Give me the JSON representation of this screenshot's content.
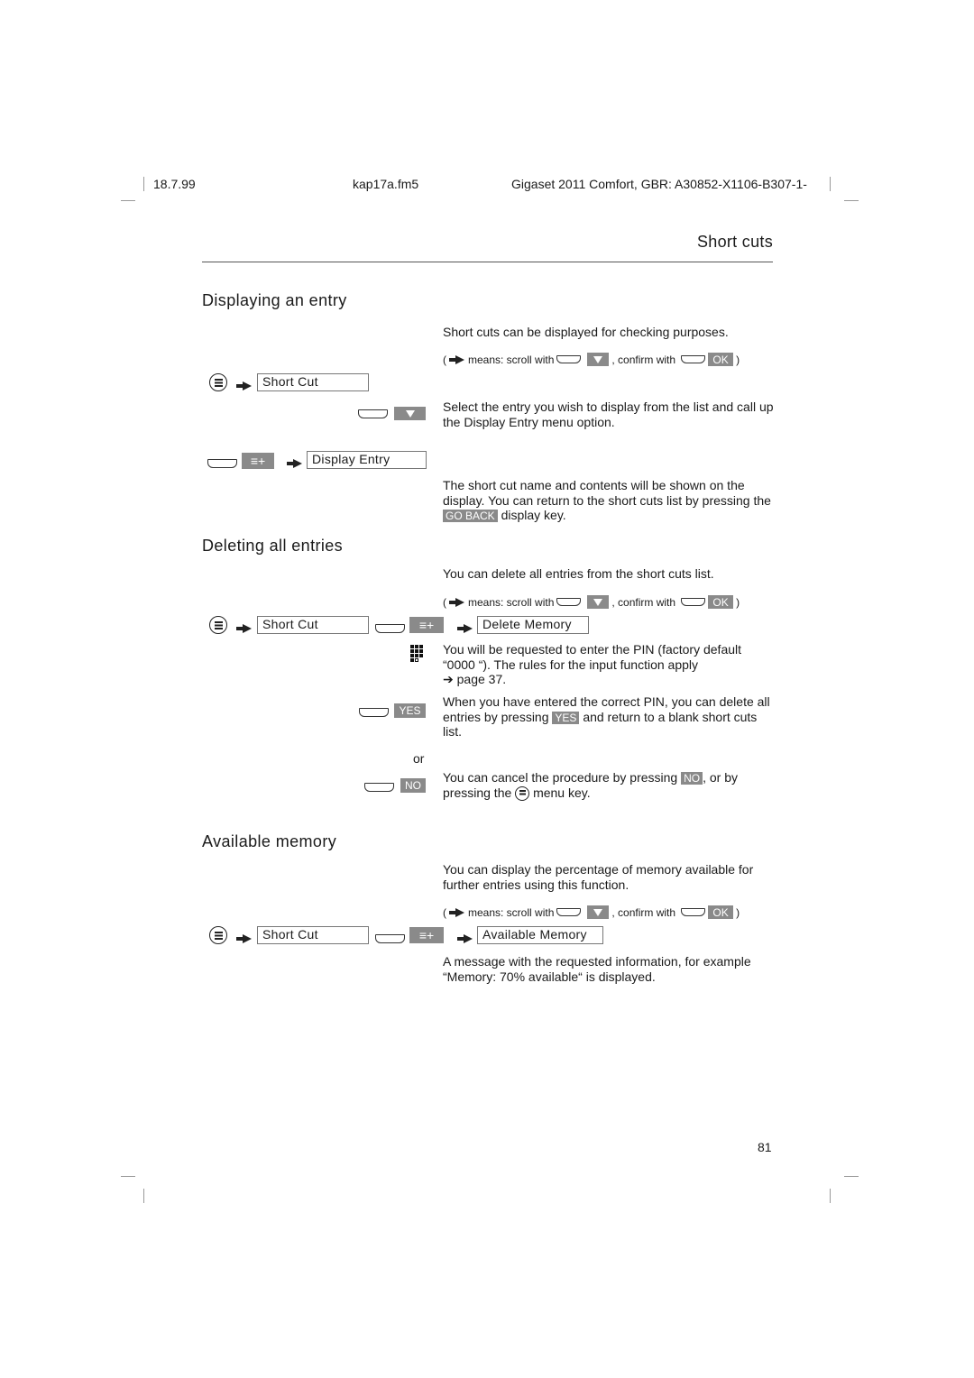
{
  "header": {
    "date": "18.7.99",
    "file": "kap17a.fm5",
    "product": "Gigaset 2011 Comfort, GBR: A30852-X1106-B307-1-"
  },
  "chapter_title": "Short cuts",
  "hint": {
    "open": "(",
    "means": "means: scroll with",
    "confirm": ", confirm with",
    "ok_key": "OK",
    "close": ")"
  },
  "sections": {
    "display": {
      "title": "Displaying an entry",
      "intro": "Short cuts can be displayed for checking purposes.",
      "menu_box": "Short Cut",
      "select_text": "Select the entry you wish to display from the list and call up the Display Entry menu option.",
      "option_box": "Display Entry",
      "result_pre": "The short cut name and contents will be shown on the display. You can return to the short cuts list by pressing the",
      "go_back_key": "GO BACK",
      "result_post": "display key."
    },
    "delete": {
      "title": "Deleting all entries",
      "intro": "You can delete all entries from the short cuts list.",
      "menu_box": "Short Cut",
      "option_box": "Delete Memory",
      "pin_text": "You will be requested to enter the PIN (factory default “0000 “). The rules for the input function apply",
      "pin_ref": "➔ page 37.",
      "yes_key": "YES",
      "yes_pre": "When you have entered the correct PIN, you can delete all entries by pressing",
      "yes_post": "and return to a blank short cuts list.",
      "or": "or",
      "no_key": "NO",
      "no_pre": "You can cancel the procedure by pressing",
      "no_mid": ", or by pressing the",
      "no_post": "menu key."
    },
    "memory": {
      "title": "Available memory",
      "intro": "You can display the percentage of memory available for further entries using this function.",
      "menu_box": "Short Cut",
      "option_box": "Available Memory",
      "result": "A message with the requested information, for example “Memory: 70% available“ is displayed."
    }
  },
  "page_number": "81"
}
